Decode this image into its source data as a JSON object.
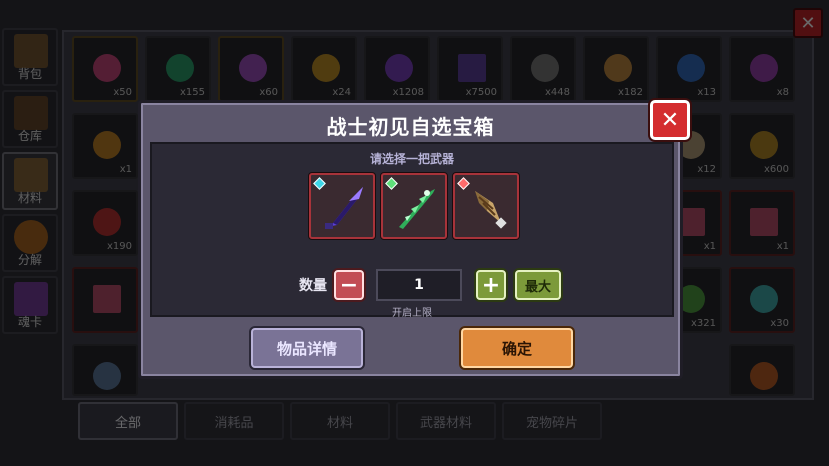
{
  "background": {
    "side_tabs": [
      {
        "label": "背包",
        "icon": "backpack-icon",
        "active": false
      },
      {
        "label": "仓库",
        "icon": "warehouse-chest-icon",
        "active": false
      },
      {
        "label": "材料",
        "icon": "materials-icon",
        "active": true
      },
      {
        "label": "分解",
        "icon": "decompose-pot-icon",
        "active": false
      },
      {
        "label": "魂卡",
        "icon": "soul-card-icon",
        "active": false
      }
    ],
    "item_counts": [
      "x50",
      "x155",
      "x60",
      "x24",
      "x1208",
      "x7500",
      "x448",
      "x182",
      "x13",
      "x8",
      "x1",
      "x12",
      "x600",
      "x190",
      "x1",
      "x1",
      "x321",
      "x30"
    ],
    "bottom_tabs": [
      {
        "label": "全部",
        "active": true
      },
      {
        "label": "消耗品",
        "active": false
      },
      {
        "label": "材料",
        "active": false
      },
      {
        "label": "武器材料",
        "active": false
      },
      {
        "label": "宠物碎片",
        "active": false
      }
    ],
    "close_label": "✕"
  },
  "modal": {
    "title": "战士初见自选宝箱",
    "close_label": "✕",
    "prompt": "请选择一把武器",
    "weapons": [
      {
        "icon": "purple-blade-icon",
        "gem_color": "#3fd7e8"
      },
      {
        "icon": "green-crystal-sword-icon",
        "gem_color": "#5fe07a"
      },
      {
        "icon": "drill-lance-icon",
        "gem_color": "#ff6b6b"
      }
    ],
    "quantity_label": "数量",
    "quantity_value": "1",
    "max_label": "最大",
    "limit_note": "开启上限",
    "detail_button": "物品详情",
    "confirm_button": "确定"
  },
  "colors": {
    "close_red": "#d42d2f",
    "confirm_orange": "#e08a3c",
    "detail_purple": "#7a7396",
    "plus_green": "#7c9a3a",
    "minus_red": "#c24d55"
  }
}
